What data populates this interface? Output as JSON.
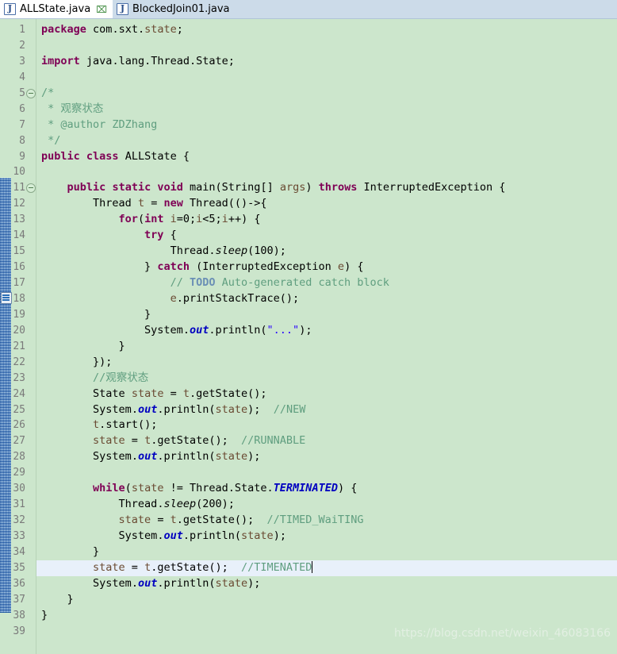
{
  "tabs": [
    {
      "label": "ALLState.java",
      "icon": "java-file-icon",
      "active": true,
      "close": "⌧"
    },
    {
      "label": "BlockedJoin01.java",
      "icon": "java-file-icon",
      "active": false,
      "close": ""
    }
  ],
  "editor": {
    "background_color": "#cce6cc",
    "current_line_color": "#e8f0fa",
    "total_lines": 39,
    "current_line": 35,
    "fold_lines": [
      5,
      11
    ],
    "todo_marker_line": 17,
    "line_numbers": [
      "1",
      "2",
      "3",
      "4",
      "5",
      "6",
      "7",
      "8",
      "9",
      "10",
      "11",
      "12",
      "13",
      "14",
      "15",
      "16",
      "17",
      "18",
      "19",
      "20",
      "21",
      "22",
      "23",
      "24",
      "25",
      "26",
      "27",
      "28",
      "29",
      "30",
      "31",
      "32",
      "33",
      "34",
      "35",
      "36",
      "37",
      "38",
      "39"
    ]
  },
  "code_lines": [
    {
      "n": 1,
      "text": "package com.sxt.state;"
    },
    {
      "n": 2,
      "text": ""
    },
    {
      "n": 3,
      "text": "import java.lang.Thread.State;"
    },
    {
      "n": 4,
      "text": ""
    },
    {
      "n": 5,
      "text": "/*"
    },
    {
      "n": 6,
      "text": " * 观察状态"
    },
    {
      "n": 7,
      "text": " * @author ZDZhang"
    },
    {
      "n": 8,
      "text": " */"
    },
    {
      "n": 9,
      "text": "public class ALLState {"
    },
    {
      "n": 10,
      "text": ""
    },
    {
      "n": 11,
      "text": "    public static void main(String[] args) throws InterruptedException {"
    },
    {
      "n": 12,
      "text": "        Thread t = new Thread(()->{"
    },
    {
      "n": 13,
      "text": "            for(int i=0;i<5;i++) {"
    },
    {
      "n": 14,
      "text": "                try {"
    },
    {
      "n": 15,
      "text": "                    Thread.sleep(100);"
    },
    {
      "n": 16,
      "text": "                } catch (InterruptedException e) {"
    },
    {
      "n": 17,
      "text": "                    // TODO Auto-generated catch block"
    },
    {
      "n": 18,
      "text": "                    e.printStackTrace();"
    },
    {
      "n": 19,
      "text": "                }"
    },
    {
      "n": 20,
      "text": "                System.out.println(\"...\");"
    },
    {
      "n": 21,
      "text": "            }"
    },
    {
      "n": 22,
      "text": "        });"
    },
    {
      "n": 23,
      "text": "        //观察状态"
    },
    {
      "n": 24,
      "text": "        State state = t.getState();"
    },
    {
      "n": 25,
      "text": "        System.out.println(state);  //NEW"
    },
    {
      "n": 26,
      "text": "        t.start();"
    },
    {
      "n": 27,
      "text": "        state = t.getState();  //RUNNABLE"
    },
    {
      "n": 28,
      "text": "        System.out.println(state);"
    },
    {
      "n": 29,
      "text": ""
    },
    {
      "n": 30,
      "text": "        while(state != Thread.State.TERMINATED) {"
    },
    {
      "n": 31,
      "text": "            Thread.sleep(200);"
    },
    {
      "n": 32,
      "text": "            state = t.getState();  //TIMED_WaiTING"
    },
    {
      "n": 33,
      "text": "            System.out.println(state);"
    },
    {
      "n": 34,
      "text": "        }"
    },
    {
      "n": 35,
      "text": "        state = t.getState();  //TIMENATED"
    },
    {
      "n": 36,
      "text": "        System.out.println(state);"
    },
    {
      "n": 37,
      "text": "    }"
    },
    {
      "n": 38,
      "text": "}"
    },
    {
      "n": 39,
      "text": ""
    }
  ],
  "watermark": {
    "text": "https://blog.csdn.net/weixin_46083166"
  },
  "colors": {
    "keyword": "#7f0055",
    "comment": "#5f9e7f",
    "todo": "#6a8fb5",
    "string": "#2a00ff",
    "static_field": "#0000c0",
    "local_var": "#6a4a32",
    "editor_bg": "#cce6cc",
    "tabbar_bg": "#ccdbe9",
    "active_tab_bg": "#ffffff"
  }
}
